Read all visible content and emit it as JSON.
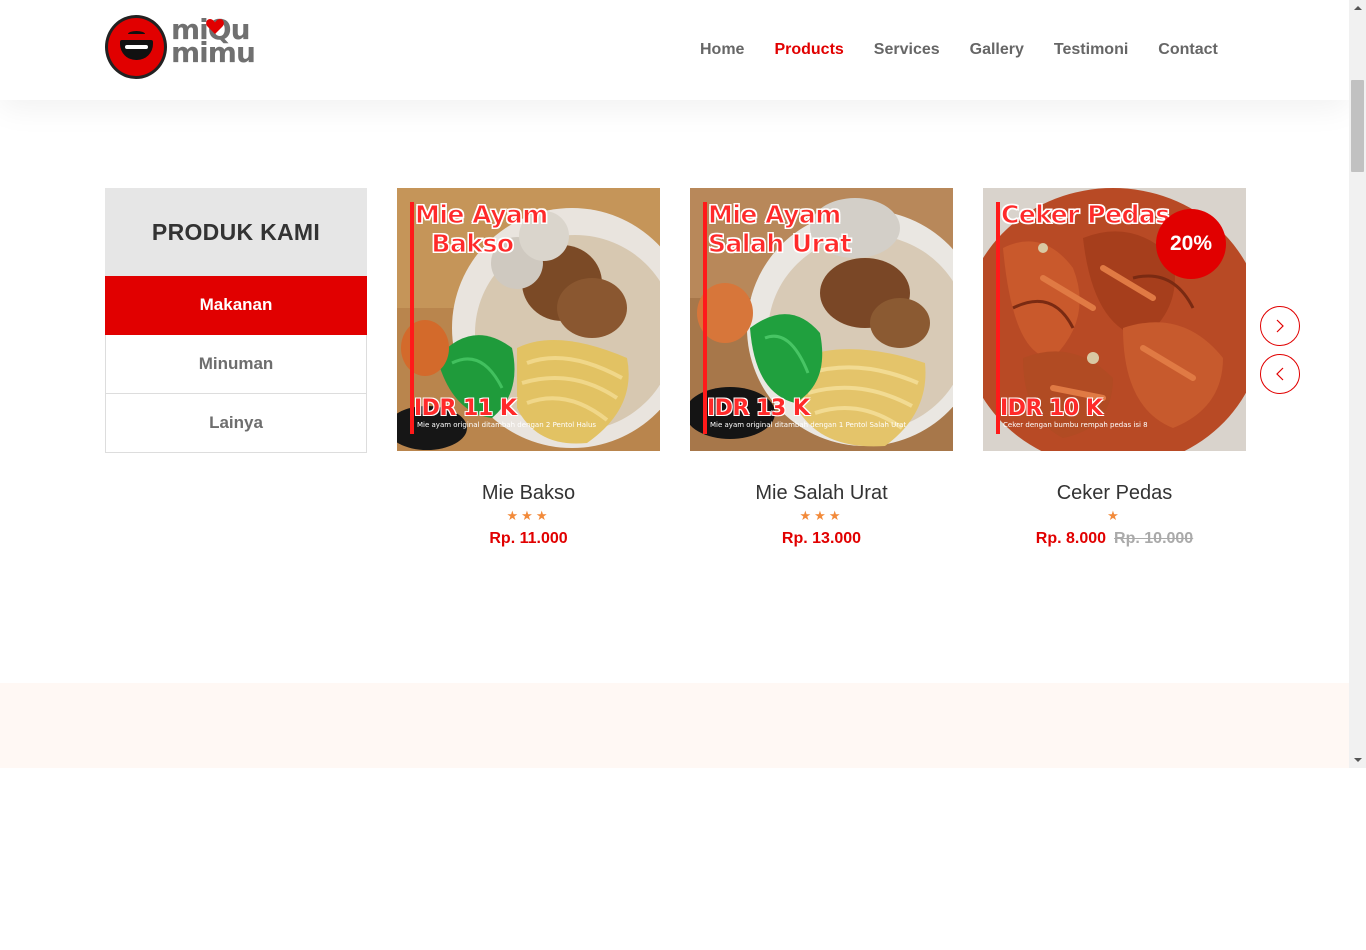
{
  "logo": {
    "line1": "miQu",
    "line2": "mimu"
  },
  "nav": {
    "items": [
      {
        "label": "Home",
        "active": false
      },
      {
        "label": "Products",
        "active": true
      },
      {
        "label": "Services",
        "active": false
      },
      {
        "label": "Gallery",
        "active": false
      },
      {
        "label": "Testimoni",
        "active": false
      },
      {
        "label": "Contact",
        "active": false
      }
    ]
  },
  "sidebar": {
    "title": "PRODUK KAMI",
    "items": [
      {
        "label": "Makanan",
        "active": true
      },
      {
        "label": "Minuman",
        "active": false
      },
      {
        "label": "Lainya",
        "active": false
      }
    ]
  },
  "products": [
    {
      "name": "Mie Bakso",
      "rating": 3,
      "stars": "★★★",
      "price": "Rp. 11.000",
      "image": {
        "title": "Mie Ayam\n  Bakso",
        "price": "IDR 11 K",
        "caption": "Mie ayam original ditambah dengan 2 Pentol Halus"
      }
    },
    {
      "name": "Mie Salah Urat",
      "rating": 3,
      "stars": "★★★",
      "price": "Rp. 13.000",
      "image": {
        "title": "Mie Ayam\nSalah Urat",
        "price": "IDR 13 K",
        "caption": "Mie ayam original ditambah dengan 1 Pentol Salah Urat"
      }
    },
    {
      "name": "Ceker Pedas",
      "rating": 1,
      "stars": "★",
      "price": "Rp. 8.000",
      "old_price": "Rp. 10.000",
      "discount": "20%",
      "image": {
        "title": "Ceker Pedas",
        "price": "IDR 10 K",
        "caption": "Ceker dengan bumbu rempah pedas isi 8"
      }
    }
  ],
  "slider": {
    "next_icon": "chevron-right-icon",
    "prev_icon": "chevron-left-icon"
  },
  "colors": {
    "accent": "#e10000",
    "star": "#f28a3a",
    "muted": "#666666",
    "band": "#fff8f4"
  }
}
